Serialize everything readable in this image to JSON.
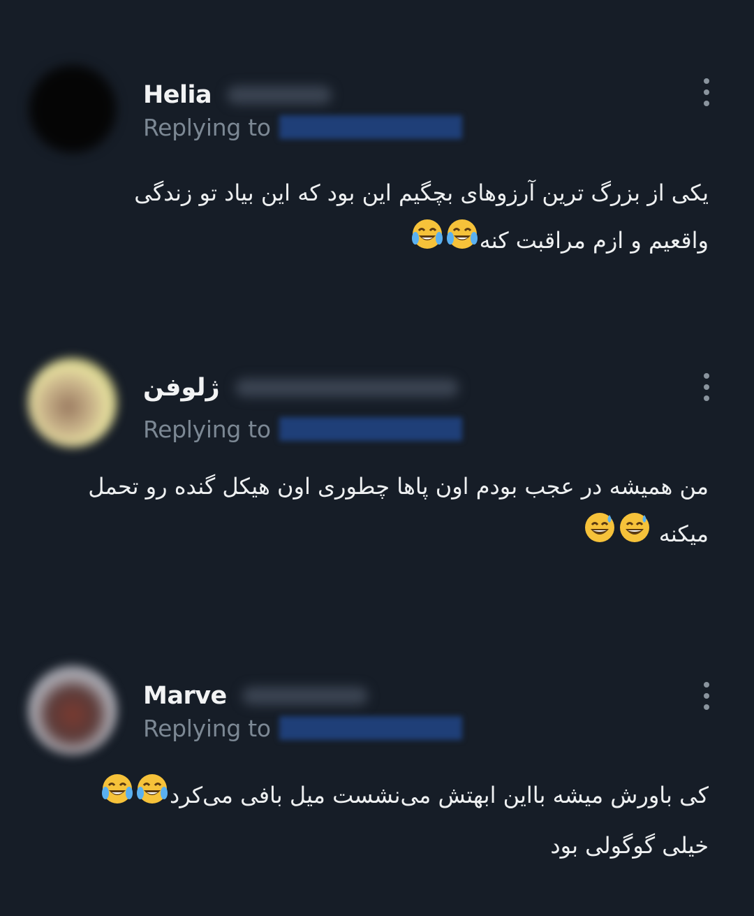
{
  "colors": {
    "background": "#161d27",
    "text_primary": "#eef0f1",
    "text_secondary": "#7c8894",
    "reply_blur": "#1f3f78",
    "emoji_face": "#f6c23a"
  },
  "replies": [
    {
      "name": "Helia",
      "replying_label": "Replying to",
      "lines": [
        "یکی از بزرگ ترین آرزوهای بچگیم این بود که این بیاد تو زندگی",
        "واقعیم و ازم مراقبت کنه"
      ],
      "emoji": "face-with-tears-of-joy-icon"
    },
    {
      "name": "ژلوفن",
      "replying_label": "Replying to",
      "lines": [
        "من همیشه در عجب بودم اون پاها چطوری اون هیکل گنده رو تحمل",
        "میکنه"
      ],
      "emoji": "grinning-face-with-sweat-icon"
    },
    {
      "name": "Marve",
      "replying_label": "Replying to",
      "lines": [
        "کی باورش میشه بااین ابهتش می‌نشست میل بافی می‌کرد",
        "خیلی گوگولی بود"
      ],
      "emoji": "face-with-tears-of-joy-icon"
    }
  ]
}
